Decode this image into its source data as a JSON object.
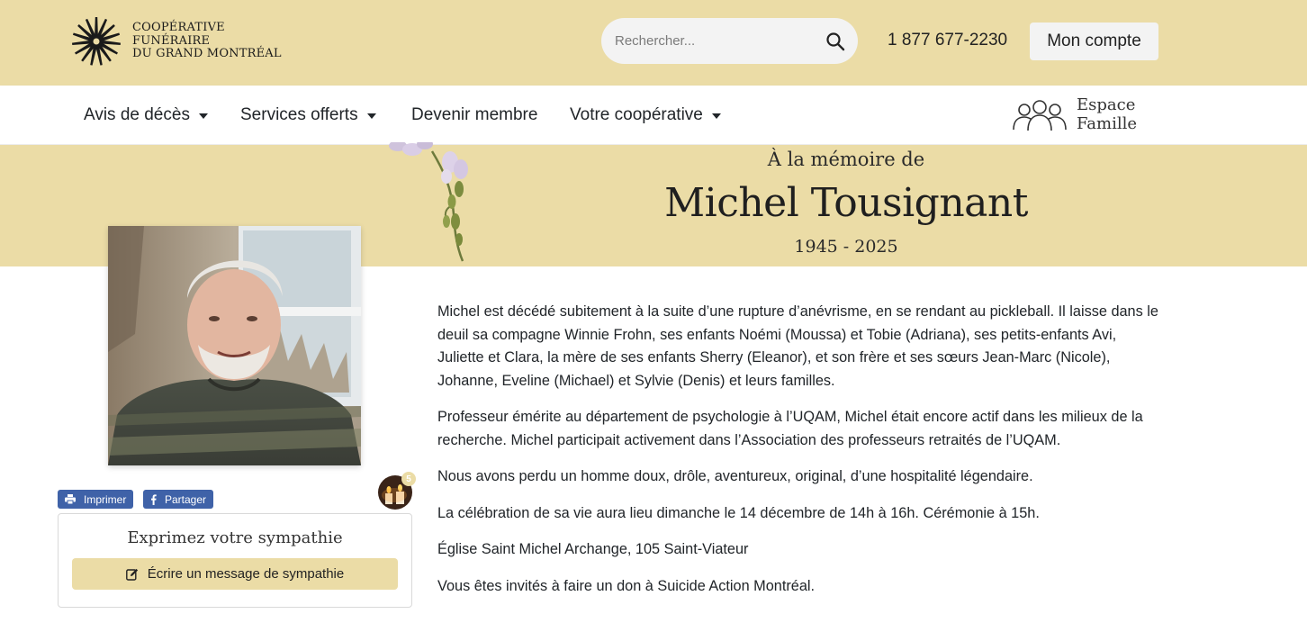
{
  "header": {
    "logo_lines": [
      "COOPÉRATIVE",
      "FUNÉRAIRE",
      "DU GRAND MONTRÉAL"
    ],
    "search_placeholder": "Rechercher...",
    "phone": "1 877 677-2230",
    "account_label": "Mon compte"
  },
  "nav": {
    "items": [
      {
        "label": "Avis de décès",
        "dropdown": true
      },
      {
        "label": "Services offerts",
        "dropdown": true
      },
      {
        "label": "Devenir membre",
        "dropdown": false
      },
      {
        "label": "Votre coopérative",
        "dropdown": true
      }
    ],
    "espace_lines": [
      "Espace",
      "Famille"
    ]
  },
  "hero": {
    "subtitle": "À la mémoire de",
    "name": "Michel Tousignant",
    "dates": "1945 - 2025"
  },
  "actions": {
    "print_label": "Imprimer",
    "share_label": "Partager",
    "candle_count": "5"
  },
  "sympathy": {
    "title": "Exprimez votre sympathie",
    "button_label": "Écrire un message de sympathie"
  },
  "obituary": {
    "paragraphs": [
      "Michel est décédé subitement à la suite d’une rupture d’anévrisme, en se rendant au pickleball. Il laisse dans le deuil sa compagne Winnie Frohn, ses enfants Noémi (Moussa) et Tobie (Adriana), ses petits-enfants Avi, Juliette et Clara,  la mère de ses enfants Sherry (Eleanor), et son frère et ses sœurs  Jean-Marc (Nicole), Johanne, Eveline (Michael) et Sylvie (Denis) et leurs familles.",
      "Professeur émérite au département de psychologie à l’UQAM, Michel était encore actif dans les milieux de la recherche. Michel participait activement dans l’Association des professeurs retraités de l’UQAM.",
      "Nous avons perdu un homme doux, drôle, aventureux, original, d’une hospitalité légendaire.",
      "La célébration de sa vie aura lieu dimanche le 14 décembre de 14h à 16h. Cérémonie à 15h.",
      "Église Saint Michel Archange, 105 Saint-Viateur",
      "Vous êtes invités à faire un don à Suicide Action Montréal."
    ]
  },
  "colors": {
    "beige": "#ebdca6",
    "share_blue": "#3f62a8",
    "text": "#212529"
  },
  "icons": [
    "logo-sunburst-icon",
    "search-icon",
    "caret-down-icon",
    "family-icon",
    "printer-icon",
    "facebook-icon",
    "edit-icon",
    "candle-icon"
  ]
}
